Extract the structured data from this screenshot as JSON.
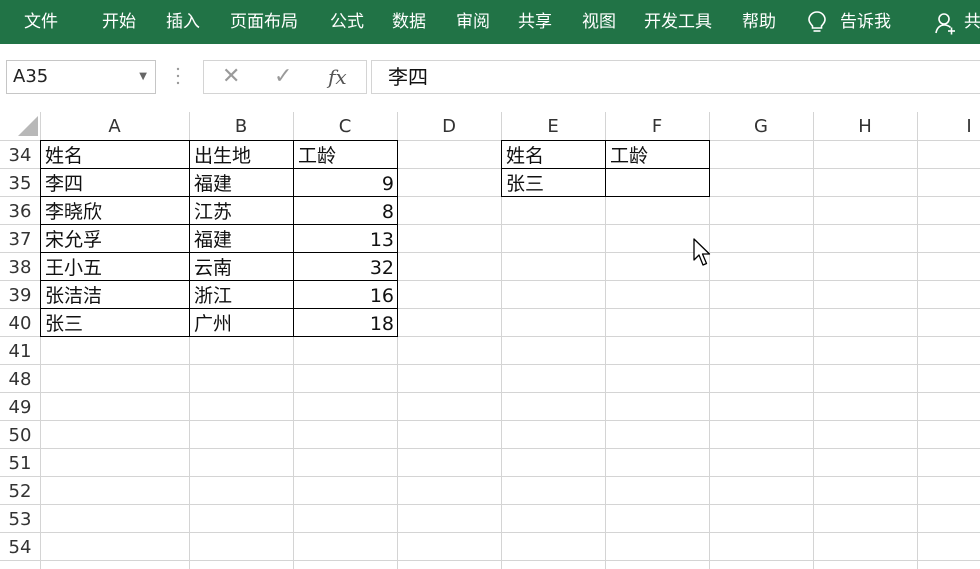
{
  "ribbon": {
    "tabs": [
      "文件",
      "开始",
      "插入",
      "页面布局",
      "公式",
      "数据",
      "审阅",
      "共享",
      "视图",
      "开发工具",
      "帮助"
    ],
    "tell_me": "告诉我",
    "share_partial": "共"
  },
  "formula_bar": {
    "name_box": "A35",
    "fx_label": "fx",
    "formula": "李四"
  },
  "columns": [
    "A",
    "B",
    "C",
    "D",
    "E",
    "F",
    "G",
    "H",
    "I"
  ],
  "rows": [
    "34",
    "35",
    "36",
    "37",
    "38",
    "39",
    "40",
    "41",
    "48",
    "49",
    "50",
    "51",
    "52",
    "53",
    "54"
  ],
  "table1": {
    "headers": [
      "姓名",
      "出生地",
      "工龄"
    ],
    "rows": [
      [
        "李四",
        "福建",
        "9"
      ],
      [
        "李晓欣",
        "江苏",
        "8"
      ],
      [
        "宋允孚",
        "福建",
        "13"
      ],
      [
        "王小五",
        "云南",
        "32"
      ],
      [
        "张洁洁",
        "浙江",
        "16"
      ],
      [
        "张三",
        "广州",
        "18"
      ]
    ]
  },
  "table2": {
    "headers": [
      "姓名",
      "工龄"
    ],
    "rows": [
      [
        "张三",
        ""
      ]
    ]
  },
  "colors": {
    "ribbon": "#217346",
    "gridline": "#d4d4d4",
    "border": "#000000",
    "header_bg": "#ffffff"
  }
}
